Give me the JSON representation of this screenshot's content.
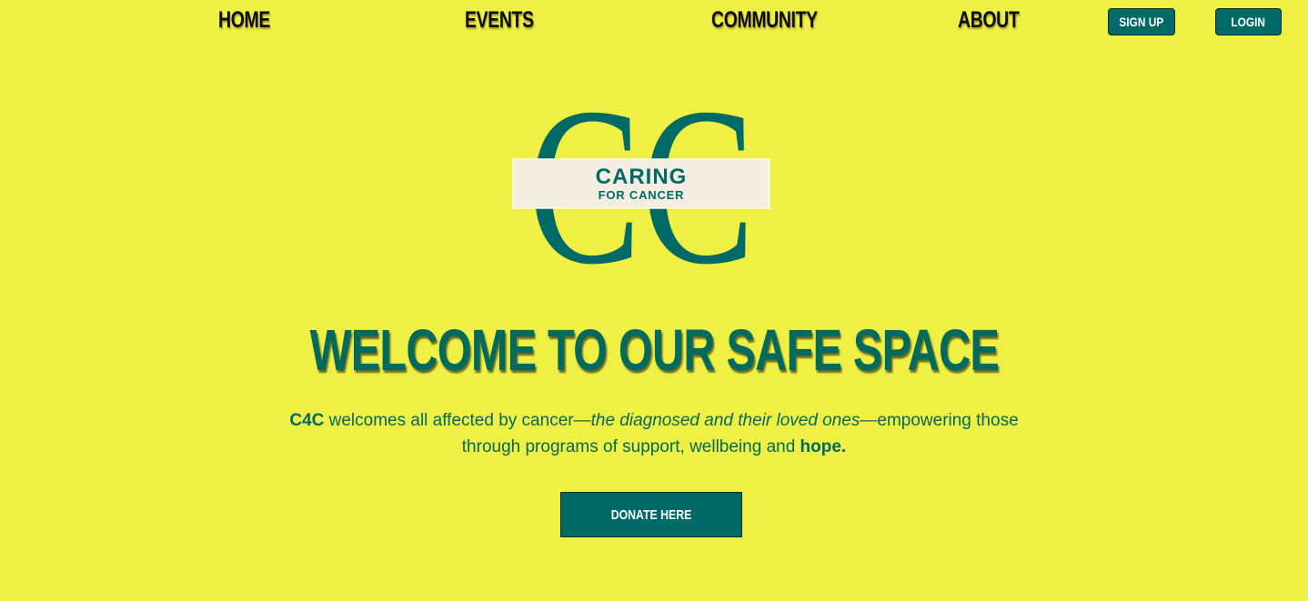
{
  "nav": {
    "home": "HOME",
    "events": "EVENTS",
    "community": "COMMUNITY",
    "about": "ABOUT",
    "signup": "SIGN UP",
    "login": "LOGIN"
  },
  "logo": {
    "monogram": "CC",
    "line1": "CARING",
    "line2": "FOR CANCER"
  },
  "hero": {
    "headline": "WELCOME TO OUR SAFE SPACE",
    "tagline": {
      "brand": "C4C",
      "part1": " welcomes all affected by cancer—",
      "italic": "the diagnosed and their loved ones",
      "part2": "—empowering those through programs of support, wellbeing and ",
      "bold_end": "hope."
    },
    "donate_label": "DONATE HERE"
  },
  "colors": {
    "background": "#f0ef44",
    "teal": "#006b66",
    "logo_band": "#f3eee0"
  }
}
